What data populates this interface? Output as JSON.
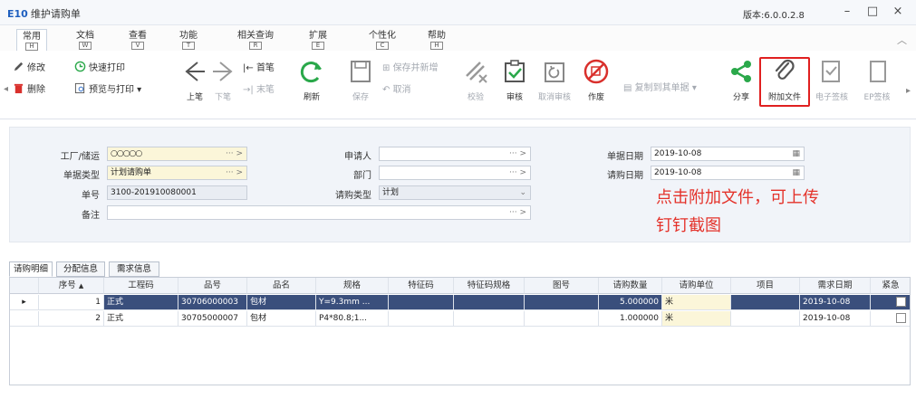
{
  "window": {
    "app_code": "E10",
    "title": "维护请购单",
    "version": "版本:6.0.0.2.8",
    "controls": [
      "–",
      "□",
      "×"
    ]
  },
  "ribbon_tabs": [
    {
      "label": "常用",
      "hotkey": "H",
      "active": true
    },
    {
      "label": "文档",
      "hotkey": "W"
    },
    {
      "label": "查看",
      "hotkey": "V"
    },
    {
      "label": "功能",
      "hotkey": "T"
    },
    {
      "label": "相关查询",
      "hotkey": "R"
    },
    {
      "label": "扩展",
      "hotkey": "E"
    },
    {
      "label": "个性化",
      "hotkey": "C"
    },
    {
      "label": "帮助",
      "hotkey": "H"
    }
  ],
  "toolbar": {
    "edit": "修改",
    "delete": "删除",
    "quick_print": "快速打印",
    "preview_print": "预览与打印",
    "prev": "上笔",
    "next": "下笔",
    "first": "首笔",
    "last": "末笔",
    "refresh": "刷新",
    "save": "保存",
    "save_and_new": "保存并新增",
    "cancel": "取消",
    "verify": "校验",
    "approve": "审核",
    "unapprove": "取消审核",
    "void": "作废",
    "copy_to": "复制到其单据",
    "share": "分享",
    "attach_file": "附加文件",
    "e_signature": "电子签核",
    "ep_signature": "EP签核",
    "colors": {
      "green": "#2aa84a",
      "red": "#d9302c",
      "blue": "#2f6fcc",
      "highlight": "#e02020"
    }
  },
  "form": {
    "plant_label": "工厂/储运",
    "plant_value": "○○○○○",
    "doctype_label": "单据类型",
    "doctype_value": "计划请购单",
    "docno_label": "单号",
    "docno_value": "3100-201910080001",
    "remark_label": "备注",
    "remark_value": "",
    "requester_label": "申请人",
    "requester_value": "",
    "dept_label": "部门",
    "dept_value": "",
    "reqtype_label": "请购类型",
    "reqtype_value": "计划",
    "docdate_label": "单据日期",
    "docdate_value": "2019-10-08",
    "reqdate_label": "请购日期",
    "reqdate_value": "2019-10-08",
    "lookup_suffix": "··· >"
  },
  "annotation": {
    "line1": "点击附加文件，可上传",
    "line2": "钉钉截图",
    "color": "#e4322a"
  },
  "detail_tabs": [
    "请购明细",
    "分配信息",
    "需求信息"
  ],
  "grid": {
    "headers": [
      "序号",
      "工程码",
      "品号",
      "品名",
      "规格",
      "特征码",
      "特征码规格",
      "图号",
      "请购数量",
      "请购单位",
      "项目",
      "需求日期",
      "紧急"
    ],
    "rows": [
      {
        "seq": "1",
        "process": "正式",
        "item_no": "30706000003",
        "item_name": "包材",
        "spec": "Y=9.3mm ...",
        "qty": "5.000000",
        "unit": "米",
        "date": "2019-10-08"
      },
      {
        "seq": "2",
        "process": "正式",
        "item_no": "30705000007",
        "item_name": "包材",
        "spec": "P4*80.8;1...",
        "qty": "1.000000",
        "unit": "米",
        "date": "2019-10-08"
      }
    ]
  }
}
